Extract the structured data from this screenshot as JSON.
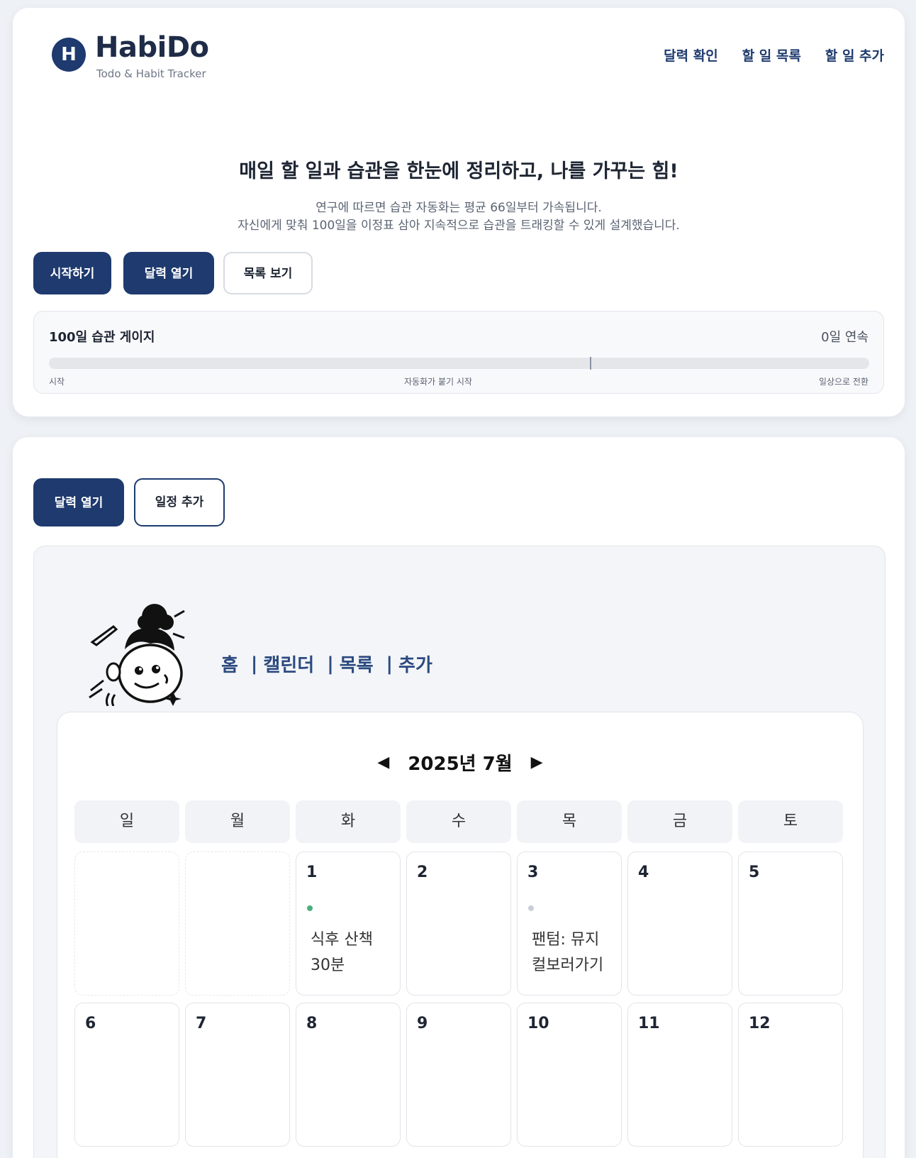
{
  "header": {
    "logo_letter": "H",
    "brand": "HabiDo",
    "tagline": "Todo & Habit Tracker",
    "nav": [
      "달력 확인",
      "할 일 목록",
      "할 일 추가"
    ]
  },
  "hero": {
    "title": "매일 할 일과 습관을 한눈에 정리하고, 나를 가꾸는 힘!",
    "desc_line1": "연구에 따르면 습관 자동화는 평균 66일부터 가속됩니다.",
    "desc_line2": "자신에게 맞춰 100일을 이정표 삼아 지속적으로 습관을 트래킹할 수 있게 설계했습니다.",
    "buttons": {
      "start": "시작하기",
      "open_calendar": "달력 열기",
      "view_list": "목록 보기"
    }
  },
  "gauge": {
    "title": "100일 습관 게이지",
    "streak": "0일 연속",
    "progress_percent": 0,
    "label_start": "시작",
    "label_mid": "자동화가 붙기 시작",
    "label_end": "일상으로 전환"
  },
  "calendar_section": {
    "buttons": {
      "open_calendar": "달력 열기",
      "add_event": "일정 추가"
    },
    "mini_nav": [
      "홈",
      "캘린더",
      "목록",
      "추가"
    ],
    "month": "2025년 7월",
    "prev_arrow": "◀",
    "next_arrow": "▶",
    "weekdays": [
      "일",
      "월",
      "화",
      "수",
      "목",
      "금",
      "토"
    ],
    "days": [
      {
        "num": "",
        "empty": true
      },
      {
        "num": "",
        "empty": true
      },
      {
        "num": "1",
        "event": "식후 산책 30분",
        "dot_color": "#4caf7d"
      },
      {
        "num": "2"
      },
      {
        "num": "3",
        "event": "팬텀: 뮤지컬보러가기",
        "dot_color": "#c9ced8"
      },
      {
        "num": "4"
      },
      {
        "num": "5"
      },
      {
        "num": "6"
      },
      {
        "num": "7"
      },
      {
        "num": "8"
      },
      {
        "num": "9"
      },
      {
        "num": "10"
      },
      {
        "num": "11"
      },
      {
        "num": "12"
      }
    ]
  },
  "colors": {
    "accent": "#1e3a6e",
    "page_bg": "#eef1f5"
  },
  "icons": {
    "logo": "logo-h-icon",
    "mascot": "girl-mascot-illustration"
  }
}
